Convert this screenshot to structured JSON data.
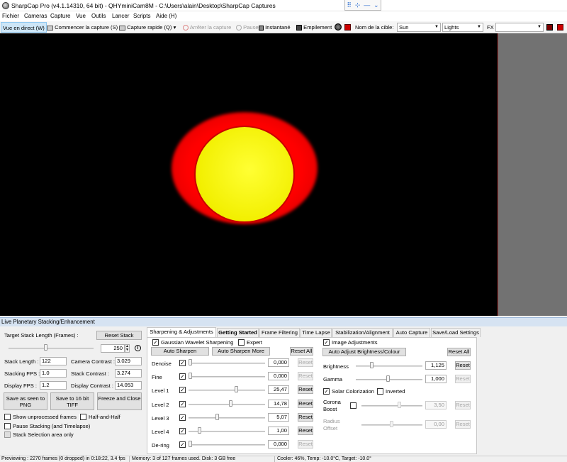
{
  "window": {
    "title": "SharpCap Pro (v4.1.14310, 64 bit) - QHYminiCam8M - C:\\Users\\alain\\Desktop\\SharpCap Captures",
    "controls": [
      "⠿",
      "⊹",
      "—",
      "⌄"
    ]
  },
  "menu": [
    "Fichier",
    "Cameras",
    "Capture",
    "Vue",
    "Outils",
    "Lancer",
    "Scripts",
    "Aide (H)"
  ],
  "toolbar": {
    "live_view": "Vue en direct (W)",
    "start_capture": "Commencer la capture (S)",
    "quick_capture": "Capture rapide (Q)",
    "quick_capture_arrow": "▾",
    "stop_capture": "Arrêter la capture",
    "pause": "Pause",
    "snapshot": "Instantané",
    "stacking": "Empilement",
    "target_label": "Nom de la cible:",
    "target_value": "Sun",
    "frame_type_value": "Lights",
    "fx_label": "FX",
    "fx_value": ""
  },
  "live_stacking": {
    "panel_title": "Live Planetary Stacking/Enhancement",
    "target_stack_length_label": "Target Stack Length (Frames) :",
    "reset_stack": "Reset Stack",
    "target_stack_length_value": "250",
    "stats": {
      "stack_length_label": "Stack Length :",
      "stack_length_value": "122",
      "camera_contrast_label": "Camera Contrast :",
      "camera_contrast_value": "3.029",
      "stacking_fps_label": "Stacking FPS :",
      "stacking_fps_value": "1.0",
      "stack_contrast_label": "Stack Contrast :",
      "stack_contrast_value": "3.274",
      "display_fps_label": "Display FPS :",
      "display_fps_value": "1.2",
      "display_contrast_label": "Display Contrast :",
      "display_contrast_value": "14.053"
    },
    "save_png": "Save as seen to PNG",
    "save_tiff": "Save to 16 bit TIFF",
    "freeze_close": "Freeze and Close",
    "show_unprocessed": "Show unprocessed frames",
    "half_and_half": "Half-and-Half",
    "pause_stacking": "Pause Stacking (and Timelapse)",
    "stack_selection": "Stack Selection area only"
  },
  "tabs": [
    "Sharpening & Adjustments",
    "Getting Started",
    "Frame Filtering",
    "Time Lapse",
    "Stabilization/Alignment",
    "Auto Capture",
    "Save/Load Settings"
  ],
  "sharpening": {
    "gaussian_label": "Gaussian Wavelet Sharpening",
    "expert_label": "Expert",
    "auto_sharpen": "Auto Sharpen",
    "auto_sharpen_more": "Auto Sharpen More",
    "reset_all": "Reset All",
    "reset": "Reset",
    "rows": [
      {
        "label": "Denoise",
        "value": "0,000",
        "level": 0.0
      },
      {
        "label": "Fine",
        "value": "0,000",
        "level": 0.0
      },
      {
        "label": "Level 1",
        "value": "25,47",
        "level": 0.6
      },
      {
        "label": "Level 2",
        "value": "14,78",
        "level": 0.53
      },
      {
        "label": "Level 3",
        "value": "5,07",
        "level": 0.35
      },
      {
        "label": "Level 4",
        "value": "1,00",
        "level": 0.12
      },
      {
        "label": "De-ring",
        "value": "0,000",
        "level": 0.0
      }
    ]
  },
  "image_adjust": {
    "label": "Image Adjustments",
    "auto_adjust": "Auto Adjust Brightness/Colour",
    "reset_all": "Reset All",
    "reset": "Reset",
    "brightness_label": "Brightness",
    "brightness_value": "1,125",
    "gamma_label": "Gamma",
    "gamma_value": "1,000",
    "solar_colorization": "Solar Colorization",
    "inverted": "Inverted",
    "corona_boost_label": "Corona Boost",
    "corona_boost_value": "3,50",
    "radius_offset_label": "Radius Offset",
    "radius_offset_value": "0,00"
  },
  "status": {
    "preview": "Previewing : 2270 frames (0 dropped) in 0:18:22, 3.4 fps",
    "memory": "Memory: 3 of 127 frames used. Disk: 3 GB free",
    "cooler": "Cooler: 46%, Temp: -10.0°C, Target: -10.0°"
  },
  "colors": {
    "accent": "#cde6f7",
    "sun_disk": "#f2ef00",
    "corona": "#ff0000",
    "panel_header": "#d6e3f2"
  }
}
